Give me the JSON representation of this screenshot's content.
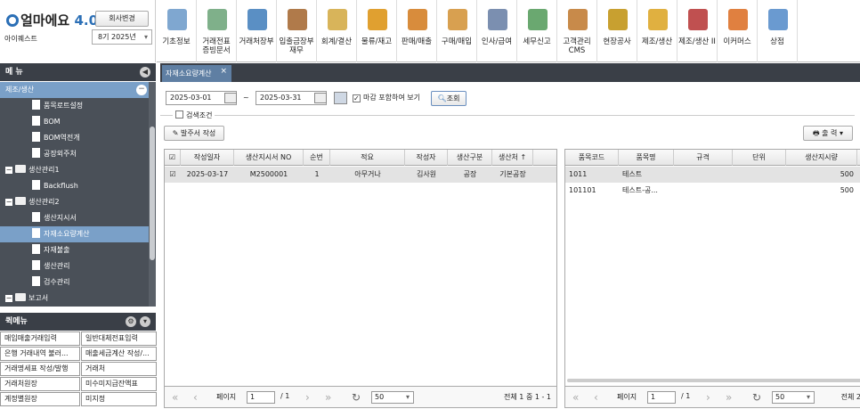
{
  "app": {
    "logo_text": "얼마에요",
    "logo_version": "4.0",
    "company_change": "회사변경",
    "site_name": "아이퀘스트",
    "fiscal_year": "8기 2025년"
  },
  "toolbar": [
    {
      "label": "기초정보",
      "icon": "basic-info-icon",
      "color": "#7fa7d0"
    },
    {
      "label": "거래전표\n증빙문서",
      "icon": "voucher-icon",
      "color": "#7fb08a"
    },
    {
      "label": "거래처장부",
      "icon": "ledger-icon",
      "color": "#5a8fc4"
    },
    {
      "label": "입출금장부\n재무",
      "icon": "cashbook-icon",
      "color": "#b07a4a"
    },
    {
      "label": "회계/결산",
      "icon": "accounting-icon",
      "color": "#d8b45a"
    },
    {
      "label": "물류/재고",
      "icon": "logistics-icon",
      "color": "#e0a030"
    },
    {
      "label": "판매/매출",
      "icon": "sales-icon",
      "color": "#d88c3c"
    },
    {
      "label": "구매/매입",
      "icon": "purchase-icon",
      "color": "#d8a050"
    },
    {
      "label": "인사/급여",
      "icon": "hr-icon",
      "color": "#7b8fb0"
    },
    {
      "label": "세무신고",
      "icon": "tax-icon",
      "color": "#6aa870"
    },
    {
      "label": "고객관리\nCMS",
      "icon": "crm-icon",
      "color": "#c88a4a"
    },
    {
      "label": "현장공사",
      "icon": "construction-icon",
      "color": "#c8a030"
    },
    {
      "label": "제조/생산",
      "icon": "manufacturing-icon",
      "color": "#e0b040"
    },
    {
      "label": "제조/생산 II",
      "icon": "factory-icon",
      "color": "#c05050"
    },
    {
      "label": "이커머스",
      "icon": "ecommerce-icon",
      "color": "#e08040"
    },
    {
      "label": "상점",
      "icon": "shop-icon",
      "color": "#6a9ad0"
    }
  ],
  "sidebar": {
    "title": "메 뉴",
    "items": [
      {
        "label": "제조/생산",
        "kind": "group"
      },
      {
        "label": "품목로트설정",
        "kind": "leaf"
      },
      {
        "label": "BOM",
        "kind": "leaf"
      },
      {
        "label": "BOM역전개",
        "kind": "leaf"
      },
      {
        "label": "공장외주처",
        "kind": "leaf"
      },
      {
        "label": "생산관리1",
        "kind": "folder"
      },
      {
        "label": "Backflush",
        "kind": "leaf"
      },
      {
        "label": "생산관리2",
        "kind": "folder"
      },
      {
        "label": "생산지시서",
        "kind": "leaf"
      },
      {
        "label": "자재소요량계산",
        "kind": "selected"
      },
      {
        "label": "자재불출",
        "kind": "leaf"
      },
      {
        "label": "생산관리",
        "kind": "leaf"
      },
      {
        "label": "검수관리",
        "kind": "leaf"
      },
      {
        "label": "보고서",
        "kind": "folder"
      }
    ]
  },
  "quickmenu": {
    "title": "퀵메뉴",
    "items": [
      "매입매출거래입력",
      "일반대체전표입력",
      "은행 거래내역 불러...",
      "매출세금계산 작성/...",
      "거래명세표 작성/발행",
      "거래처",
      "거래처원장",
      "미수미지급잔액표",
      "계정별원장",
      "미지정"
    ]
  },
  "tab": {
    "label": "자재소요량계산"
  },
  "filter": {
    "date_from": "2025-03-01",
    "tilde": "~",
    "date_to": "2025-03-31",
    "include_closed": "마감 포함하여 보기",
    "search_button": "조회",
    "search_conditions": "검색조건",
    "order_button": "발주서 작성",
    "print_button": "출 력"
  },
  "left_grid": {
    "headers": [
      "작성일자",
      "생산지시서 NO",
      "순번",
      "적요",
      "작성자",
      "생산구분",
      "생산처 ↑"
    ],
    "rows": [
      [
        "2025-03-17",
        "M2500001",
        "1",
        "아무거나",
        "김사원",
        "공장",
        "기본공장"
      ]
    ]
  },
  "right_grid": {
    "headers": [
      "품목코드",
      "품목명",
      "규격",
      "단위",
      "생산지시량"
    ],
    "rows": [
      [
        "1011",
        "테스트",
        "",
        "",
        "500"
      ],
      [
        "101101",
        "테스트-공...",
        "",
        "",
        "500"
      ]
    ]
  },
  "left_pager": {
    "page_label": "페이지",
    "page": "1",
    "of": "/ 1",
    "size": "50",
    "summary": "전체 1 중 1 - 1"
  },
  "right_pager": {
    "page_label": "페이지",
    "page": "1",
    "of": "/ 1",
    "size": "50",
    "summary": "전체 2"
  }
}
